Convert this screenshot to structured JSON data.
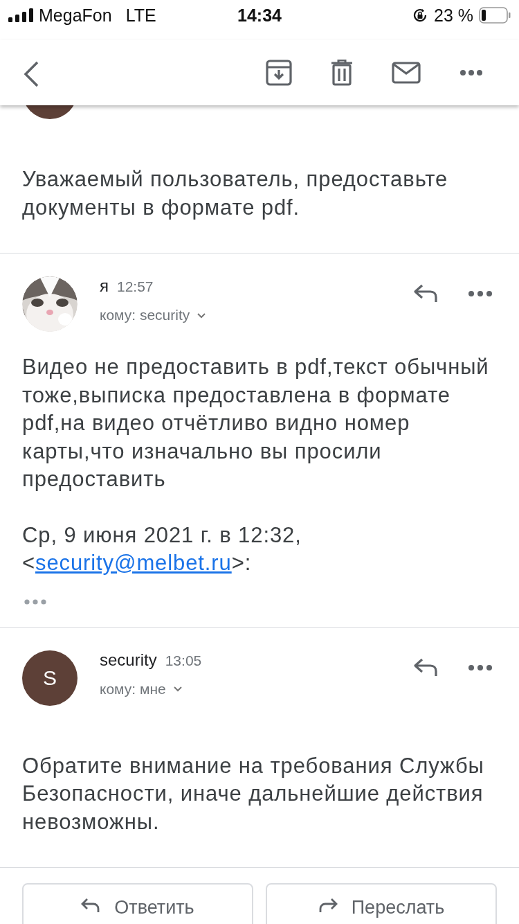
{
  "status_bar": {
    "carrier": "MegaFon",
    "network": "LTE",
    "time": "14:34",
    "battery": "23 %"
  },
  "messages": [
    {
      "avatar": {
        "kind": "letter"
      },
      "body": [
        "Уважаемый пользователь, предоставьте документы в формате pdf."
      ]
    },
    {
      "avatar": {
        "kind": "picture"
      },
      "sender": "я",
      "time": "12:57",
      "recipient": "кому: security",
      "body": [
        "Видео не предоставить в pdf,текст обычный тоже,выписка предоставлена в формате pdf,на видео отчётливо видно номер карты,что изначально вы просили предоставить"
      ],
      "quote": {
        "header": "Ср, 9 июня 2021 г. в 12:32,",
        "prefix": "<",
        "link": "security@melbet.ru",
        "suffix": ">:"
      }
    },
    {
      "avatar": {
        "kind": "letter",
        "letter": "S"
      },
      "sender": "security",
      "time": "13:05",
      "recipient": "кому: мне",
      "body": [
        "Обратите внимание на требования Службы Безопасности, иначе дальнейшие действия невозможны."
      ]
    }
  ],
  "actions": [
    {
      "kind": "reply",
      "label": "Ответить"
    },
    {
      "kind": "forward",
      "label": "Переслать"
    }
  ]
}
